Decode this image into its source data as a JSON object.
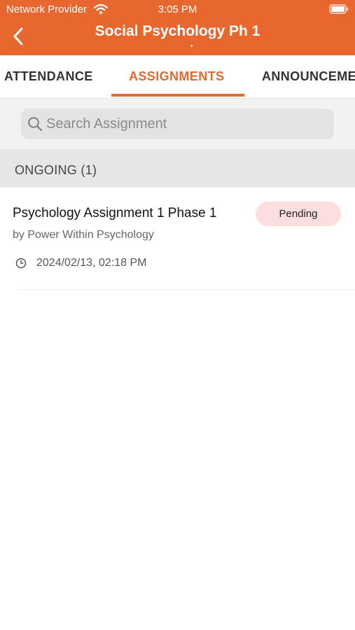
{
  "status_bar": {
    "carrier": "Network Provider",
    "time": "3:05 PM"
  },
  "header": {
    "title": "Social Psychology Ph 1"
  },
  "tabs": [
    {
      "label": "ATTENDANCE",
      "active": false
    },
    {
      "label": "ASSIGNMENTS",
      "active": true
    },
    {
      "label": "ANNOUNCEMENTS",
      "active": false
    }
  ],
  "search": {
    "placeholder": "Search Assignment",
    "value": ""
  },
  "section": {
    "title": "ONGOING (1)"
  },
  "assignments": [
    {
      "title": "Psychology Assignment 1 Phase 1",
      "author": "by Power Within Psychology",
      "date": "2024/02/13, 02:18 PM",
      "status": "Pending"
    }
  ],
  "colors": {
    "accent": "#e8672f",
    "pending_badge": "#fcdede"
  },
  "icons": [
    "wifi-icon",
    "battery-icon",
    "back-arrow-icon",
    "search-icon",
    "clock-icon"
  ]
}
